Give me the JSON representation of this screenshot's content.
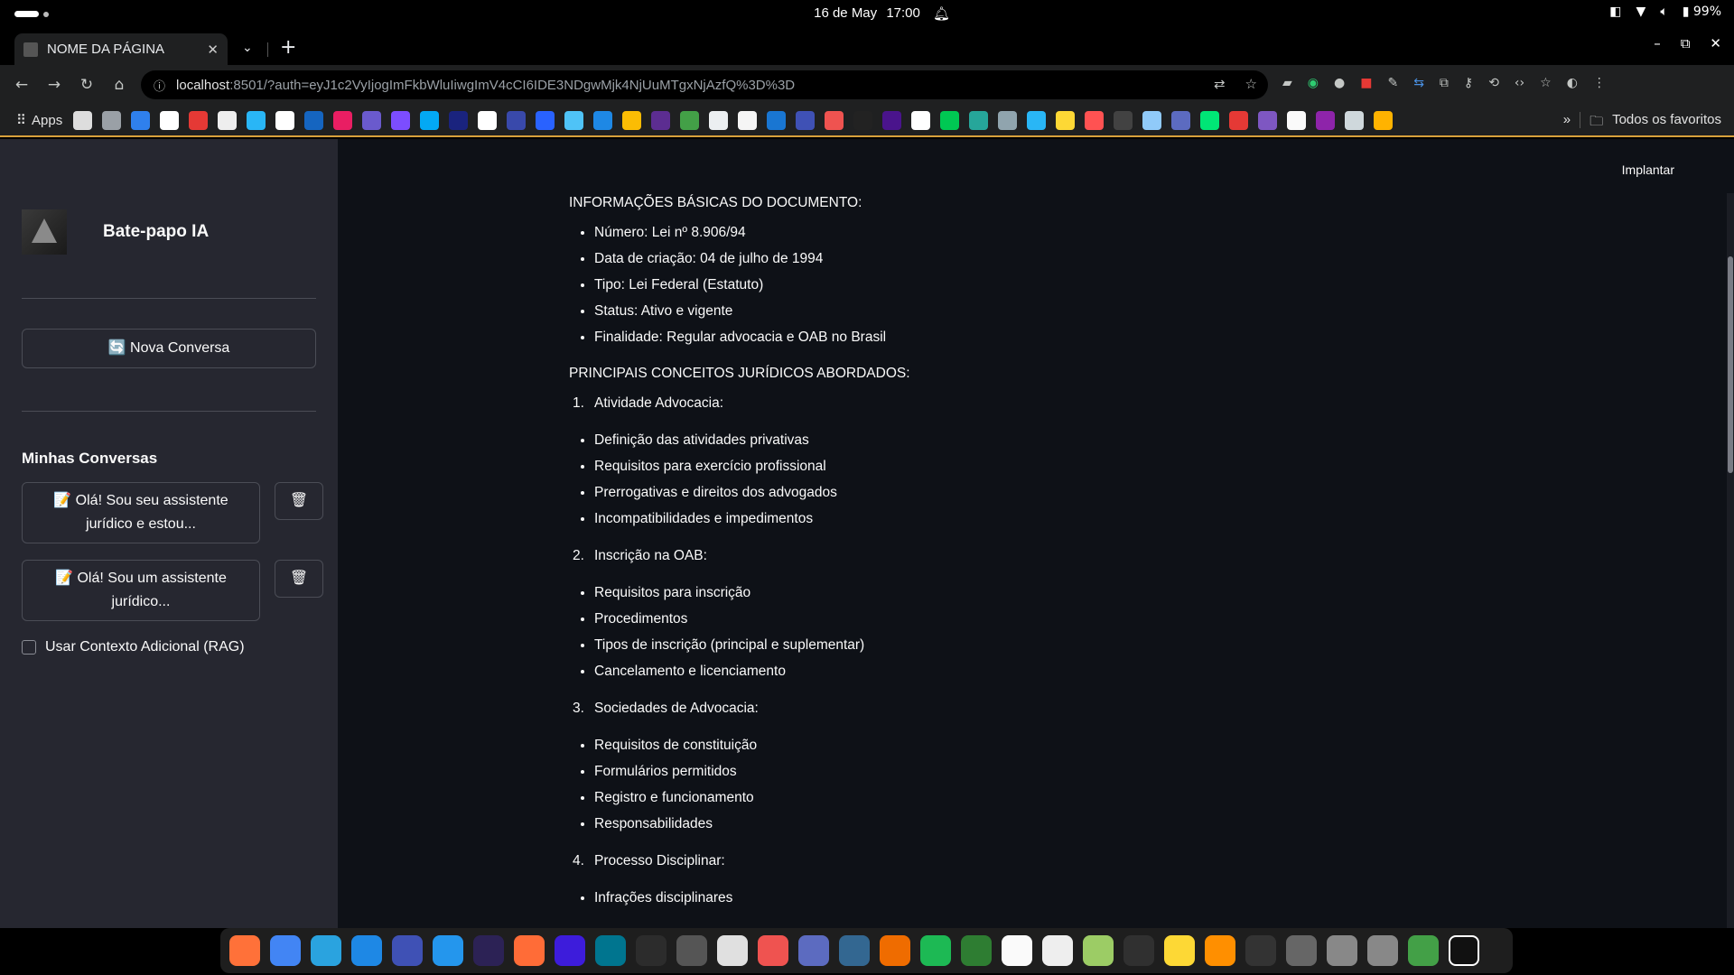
{
  "system": {
    "date": "16 de May",
    "time": "17:00",
    "battery": "99%"
  },
  "browser": {
    "tab_title": "NOME DA PÁGINA",
    "url_host": "localhost",
    "url_rest": ":8501/?auth=eyJ1c2VyIjogImFkbWluIiwgImV4cCI6IDE3NDgwMjk4NjUuMTgxNjAzfQ%3D%3D",
    "bookmarks_apps": "Apps",
    "bookmarks_all": "Todos os favoritos"
  },
  "sidebar": {
    "app_name": "Bate-papo IA",
    "new_chat": "🔄 Nova Conversa",
    "section_title": "Minhas Conversas",
    "conversations": [
      {
        "label": "📝 Olá! Sou seu assistente jurídico e estou..."
      },
      {
        "label": "📝 Olá! Sou um assistente jurídico..."
      }
    ],
    "rag_label": "Usar Contexto Adicional (RAG)"
  },
  "main": {
    "deploy": "Implantar",
    "heading_basic": "INFORMAÇÕES BÁSICAS DO DOCUMENTO:",
    "basic": [
      "Número: Lei nº 8.906/94",
      "Data de criação: 04 de julho de 1994",
      "Tipo: Lei Federal (Estatuto)",
      "Status: Ativo e vigente",
      "Finalidade: Regular advocacia e OAB no Brasil"
    ],
    "heading_concepts": "PRINCIPAIS CONCEITOS JURÍDICOS ABORDADOS:",
    "sections": [
      {
        "num": "1.",
        "title": "Atividade Advocacia:",
        "items": [
          "Definição das atividades privativas",
          "Requisitos para exercício profissional",
          "Prerrogativas e direitos dos advogados",
          "Incompatibilidades e impedimentos"
        ]
      },
      {
        "num": "2.",
        "title": "Inscrição na OAB:",
        "items": [
          "Requisitos para inscrição",
          "Procedimentos",
          "Tipos de inscrição (principal e suplementar)",
          "Cancelamento e licenciamento"
        ]
      },
      {
        "num": "3.",
        "title": "Sociedades de Advocacia:",
        "items": [
          "Requisitos de constituição",
          "Formulários permitidos",
          "Registro e funcionamento",
          "Responsabilidades"
        ]
      },
      {
        "num": "4.",
        "title": "Processo Disciplinar:",
        "items": [
          "Infrações disciplinares"
        ]
      }
    ]
  },
  "colors": {
    "sidebar_bg": "#262730",
    "main_bg": "#0e1117",
    "text": "#fafafa",
    "bookmark_border": "#d8a13b"
  }
}
